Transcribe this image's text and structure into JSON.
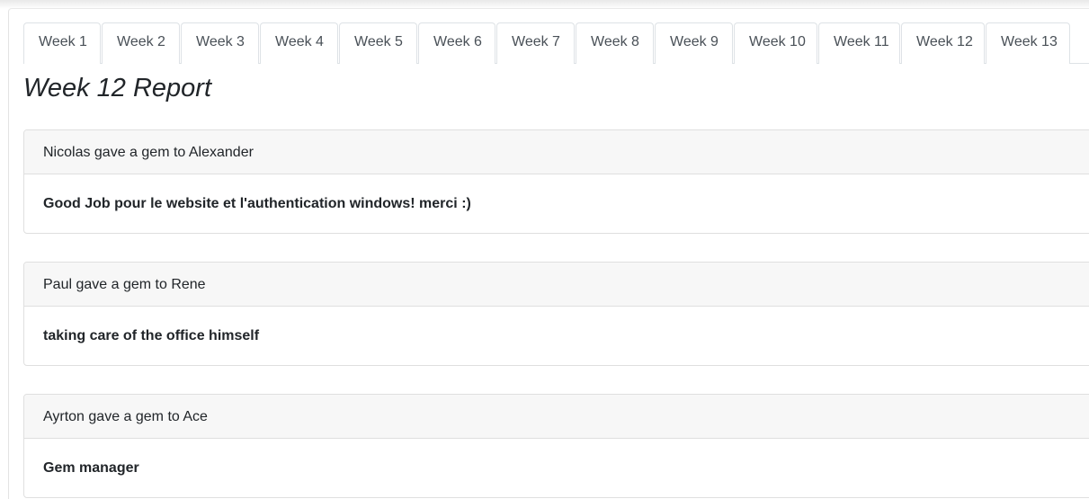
{
  "tabs": [
    {
      "label": "Week 1"
    },
    {
      "label": "Week 2"
    },
    {
      "label": "Week 3"
    },
    {
      "label": "Week 4"
    },
    {
      "label": "Week 5"
    },
    {
      "label": "Week 6"
    },
    {
      "label": "Week 7"
    },
    {
      "label": "Week 8"
    },
    {
      "label": "Week 9"
    },
    {
      "label": "Week 10"
    },
    {
      "label": "Week 11"
    },
    {
      "label": "Week 12"
    },
    {
      "label": "Week 13"
    }
  ],
  "active_tab": "Week 12",
  "report": {
    "title": "Week 12 Report",
    "gems": [
      {
        "header": "Nicolas gave a gem to Alexander",
        "message": "Good Job pour le website et l'authentication windows! merci :)"
      },
      {
        "header": "Paul gave a gem to Rene",
        "message": "taking care of the office himself"
      },
      {
        "header": "Ayrton gave a gem to Ace",
        "message": "Gem manager"
      }
    ]
  }
}
